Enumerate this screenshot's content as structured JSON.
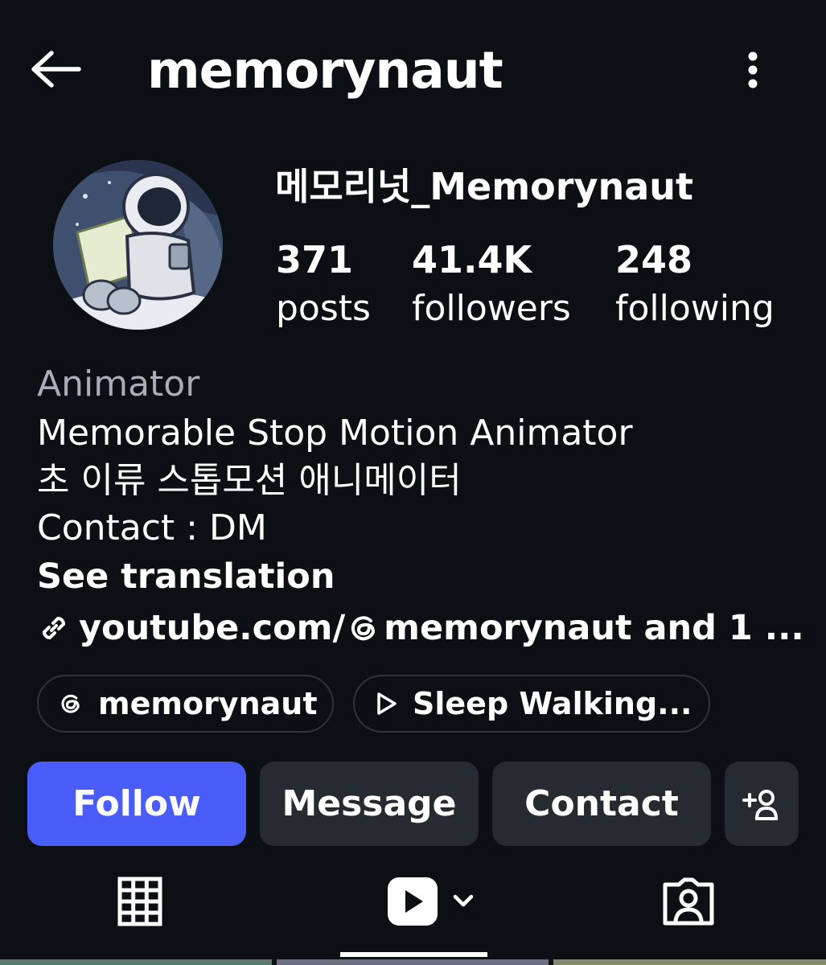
{
  "header": {
    "username": "memorynaut"
  },
  "profile": {
    "display_name": "메모리넛_Memorynaut",
    "stats": {
      "posts_count": "371",
      "posts_label": "posts",
      "followers_count": "41.4K",
      "followers_label": "followers",
      "following_count": "248",
      "following_label": "following"
    }
  },
  "bio": {
    "category": "Animator",
    "line1": "Memorable Stop Motion Animator",
    "line2": "초 이류 스톱모션 애니메이터",
    "line3": "Contact : DM",
    "see_translation": "See translation",
    "link_prefix": "youtube.com/",
    "link_suffix": "memorynaut and 1 ..."
  },
  "chips": {
    "threads_label": "memorynaut",
    "video_label": "Sleep Walking..."
  },
  "actions": {
    "follow_label": "Follow",
    "message_label": "Message",
    "contact_label": "Contact"
  },
  "icons": {
    "back": "arrow-left-icon",
    "more": "kebab-menu-icon",
    "link": "link-icon",
    "threads": "threads-icon",
    "play": "play-outline-icon",
    "add_user": "add-user-icon",
    "grid": "grid-icon",
    "reels": "reels-icon",
    "tagged": "tagged-icon"
  },
  "colors": {
    "background": "#0c0f14",
    "follow_button": "#4a5df9",
    "secondary_button": "#262a31",
    "muted_text": "#a8adb7"
  }
}
